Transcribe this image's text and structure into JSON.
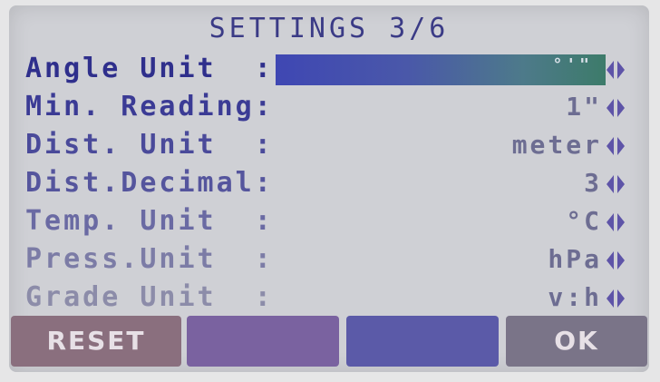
{
  "screen": {
    "title": "SETTINGS 3/6"
  },
  "settings": [
    {
      "label": "Angle Unit  :",
      "value": "°'\"",
      "selected": true
    },
    {
      "label": "Min. Reading:",
      "value": "1\""
    },
    {
      "label": "Dist. Unit  :",
      "value": "meter"
    },
    {
      "label": "Dist.Decimal:",
      "value": "3"
    },
    {
      "label": "Temp. Unit  :",
      "value": "°C"
    },
    {
      "label": "Press.Unit  :",
      "value": "hPa"
    },
    {
      "label": "Grade Unit  :",
      "value": "v:h"
    }
  ],
  "softkeys": [
    {
      "label": "RESET",
      "color": "#8a6f7e"
    },
    {
      "label": "",
      "color": "#7a62a0"
    },
    {
      "label": "",
      "color": "#5b5aa8"
    },
    {
      "label": "OK",
      "color": "#7a7488"
    }
  ],
  "colors": {
    "row_label_fade": [
      "#2f2f8c",
      "#3b3b95",
      "#4a4a9a",
      "#55559d",
      "#6a6aa3",
      "#7c7ca6",
      "#8c8ca9"
    ],
    "value_text": "#6d6d92",
    "arrow_color": "#5e54a8"
  }
}
